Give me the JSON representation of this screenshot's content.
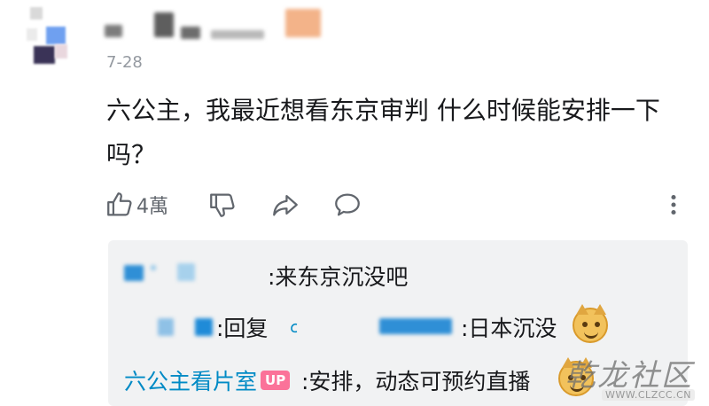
{
  "comment": {
    "date": "7-28",
    "content": "六公主，我最近想看东京审判 什么时候能安排一下吗？",
    "like_count": "4萬"
  },
  "replies": [
    {
      "text": ":来东京沉没吧"
    },
    {
      "prefix": ":回复",
      "text": ":日本沉没"
    },
    {
      "username": "六公主看片室",
      "badge": "UP",
      "text": ":安排，动态可预约直播"
    }
  ],
  "icons": {
    "like": "thumbs-up-icon",
    "dislike": "thumbs-down-icon",
    "share": "share-arrow-icon",
    "reply": "comment-bubble-icon",
    "more": "more-vertical-icon",
    "mention": "at-mention-icon",
    "emoji": "doge-emoji-icon"
  },
  "colors": {
    "link_blue": "#008ac5",
    "up_badge": "#fb7299",
    "reply_bg": "#f1f2f3",
    "meta_gray": "#9499a0"
  },
  "watermark": {
    "title": "乾龙社区",
    "url": "WWW.CLZCC.CN"
  }
}
